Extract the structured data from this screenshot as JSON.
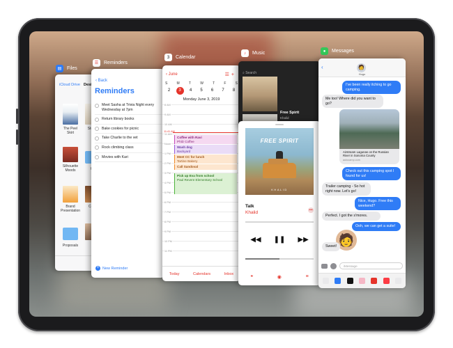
{
  "apps": {
    "files": {
      "name": "Files",
      "back": "iCloud Drive",
      "folder": "Desig",
      "items": [
        "The Peel Skirt",
        "Storyb",
        "Silhouette Moods",
        "Co",
        "Brand Presentation",
        "Color",
        "Proposals",
        "R"
      ],
      "tabbar": "Recents"
    },
    "reminders": {
      "name": "Reminders",
      "back": "Back",
      "title": "Reminders",
      "items": [
        "Meet Sasha at Trivia Night every Wednesday at 7pm",
        "Return library books",
        "Bake cookies for picnic",
        "Take Charlie to the vet",
        "Rock climbing class",
        "Movies with Kari"
      ],
      "new": "New Reminder"
    },
    "calendar": {
      "name": "Calendar",
      "month": "June",
      "weekdays": [
        "S",
        "M",
        "T",
        "W",
        "T",
        "F",
        "S"
      ],
      "dates": [
        "2",
        "3",
        "4",
        "5",
        "6",
        "7",
        "8"
      ],
      "subtitle": "Monday  June 3, 2019",
      "hours": [
        "8 AM",
        "9 AM",
        "10 AM",
        "11 AM",
        "Noon",
        "1 PM",
        "2 PM",
        "3 PM",
        "4 PM",
        "5 PM",
        "6 PM",
        "7 PM",
        "8 PM",
        "9 PM",
        "10 PM",
        "11 PM"
      ],
      "now": "11:41 AM",
      "events": [
        {
          "title": "Coffee with Ravi",
          "place": "Philz Coffee"
        },
        {
          "title": "Wash dog",
          "place": "Backyard"
        },
        {
          "title": "Meet CC for lunch",
          "place": "Tartine Bakery"
        },
        {
          "title": "Call Sandoval",
          "place": ""
        },
        {
          "title": "Pick up Eva from school",
          "place": "Paul Revere Elementary School"
        }
      ],
      "tabs": [
        "Today",
        "Calendars",
        "Inbox"
      ]
    },
    "music": {
      "name": "Music",
      "search": "Search",
      "card_title": "Free Spirit",
      "card_sub": "Khalid",
      "album_text": "FREE SPIRIT",
      "album_foot": "KHALID",
      "track": "Talk",
      "artist": "Khalid"
    },
    "messages": {
      "name": "Messages",
      "contact": "Hugo",
      "bubbles": [
        "I've been really itching to go camping.",
        "Me too! Where did you want to go?",
        "Check out this camping spot I found for us!",
        "Trailer camping - So hot right now. Let's go!",
        "Nice, Hugo. Free this weekend?",
        "Perfect. I got the s'mores.",
        "Ooh, we can get a suite!",
        "Sweet!"
      ],
      "link_title": "Airstream Lagunas on the Russian River in Sonoma County",
      "link_url": "autocamp.com",
      "placeholder": "iMessage"
    }
  },
  "colors": {
    "accent_blue": "#2f7cf6",
    "accent_red": "#e5332a",
    "files_icon": "#2f7cf6",
    "messages_icon": "#34c759",
    "music_icon": "#fc3c44"
  }
}
